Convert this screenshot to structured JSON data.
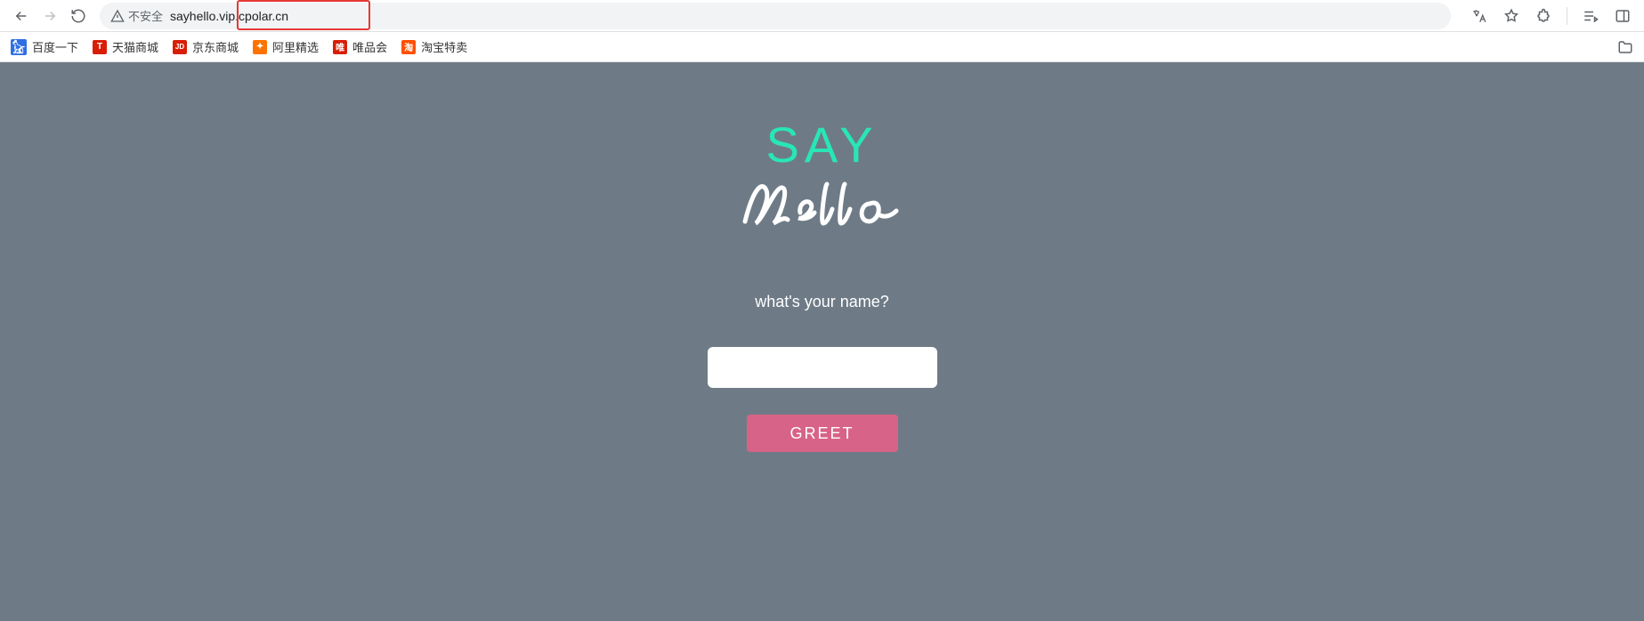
{
  "browser": {
    "security_label": "不安全",
    "url": "sayhello.vip.cpolar.cn"
  },
  "bookmarks": {
    "items": [
      {
        "label": "百度一下"
      },
      {
        "label": "天猫商城"
      },
      {
        "label": "京东商城"
      },
      {
        "label": "阿里精选"
      },
      {
        "label": "唯品会"
      },
      {
        "label": "淘宝特卖"
      }
    ]
  },
  "page": {
    "heading_top": "SAY",
    "prompt": "what's your name?",
    "name_value": "",
    "greet_label": "GREET"
  },
  "colors": {
    "page_bg": "#6e7b87",
    "accent_green": "#29e6b6",
    "button_pink": "#d86388",
    "highlight_red": "#e53935"
  }
}
